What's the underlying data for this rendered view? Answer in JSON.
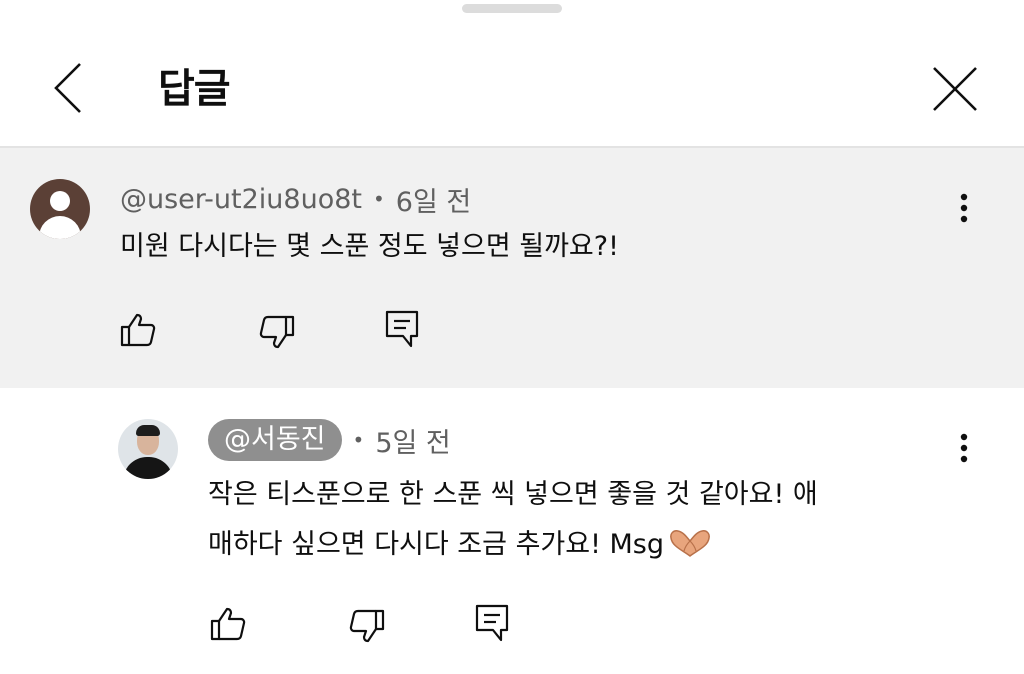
{
  "header": {
    "title": "답글"
  },
  "icons": {
    "back": "chevron-left-icon",
    "close": "close-icon",
    "more": "more-vert-icon",
    "like": "thumbs-up-icon",
    "dislike": "thumbs-down-icon",
    "reply": "reply-icon"
  },
  "colors": {
    "parent_background": "#f1f1f1",
    "author_chip": "#8f8f8f",
    "meta_text": "#606060",
    "default_avatar": "#5b4036"
  },
  "parent_comment": {
    "author": "@user-ut2iu8uo8t",
    "time": "6일 전",
    "separator": "•",
    "text": "미원 다시다는 몇 스푼 정도 넣으면 될까요?!"
  },
  "reply": {
    "author": "@서동진",
    "time": "5일 전",
    "separator": "•",
    "text_line1": "작은 티스푼으로 한 스푼 씩 넣으면 좋을 것 같아요! 애",
    "text_line2": "매하다 싶으면 다시다 조금 추가요! Msg",
    "emoji": "heart-hands-emoji"
  }
}
